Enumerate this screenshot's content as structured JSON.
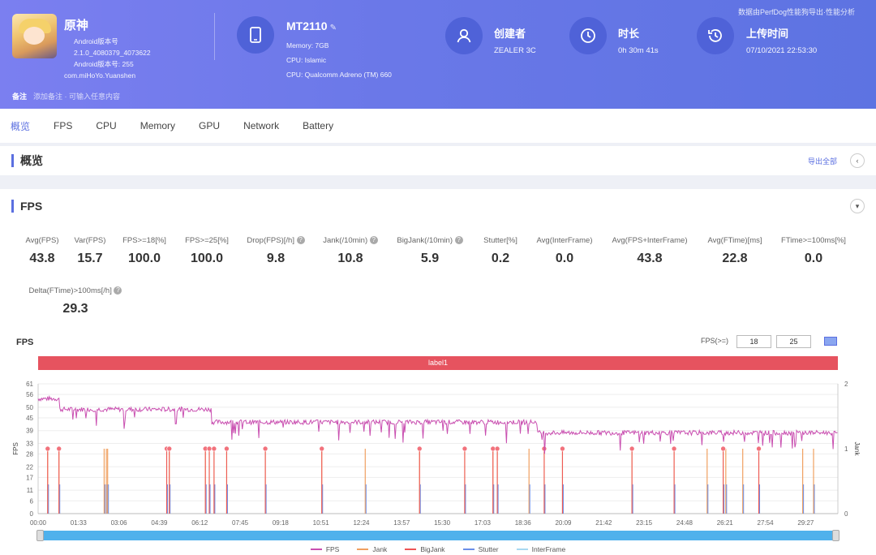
{
  "header": {
    "top_note": "数据由PerfDog性能狗导出·性能分析",
    "app": {
      "name": "原神",
      "lines": [
        "Android版本号",
        "2.1.0_4080379_4073622",
        "Android版本号: 255",
        "com.miHoYo.Yuanshen"
      ]
    },
    "device": {
      "name": "MT2110",
      "edit": "✎",
      "lines": [
        "Memory: 7GB",
        "CPU: Islamic",
        "CPU: Qualcomm Adreno (TM) 660"
      ]
    },
    "creator": {
      "label": "创建者",
      "value": "ZEALER 3C"
    },
    "duration": {
      "label": "时长",
      "value": "0h 30m 41s"
    },
    "upload": {
      "label": "上传时间",
      "value": "07/10/2021 22:53:30"
    },
    "note": {
      "label": "备注",
      "value": "添加备注 · 可输入任意内容"
    }
  },
  "tabs": [
    "概览",
    "FPS",
    "CPU",
    "Memory",
    "GPU",
    "Network",
    "Battery"
  ],
  "overview": {
    "title": "概览",
    "export": "导出全部",
    "collapse": "‹"
  },
  "fps": {
    "title": "FPS",
    "toggle": "▾",
    "metrics": [
      {
        "label": "Avg(FPS)",
        "value": "43.8",
        "info": false
      },
      {
        "label": "Var(FPS)",
        "value": "15.7",
        "info": false
      },
      {
        "label": "FPS>=18[%]",
        "value": "100.0",
        "info": false
      },
      {
        "label": "FPS>=25[%]",
        "value": "100.0",
        "info": false
      },
      {
        "label": "Drop(FPS)[/h]",
        "value": "9.8",
        "info": true
      },
      {
        "label": "Jank(/10min)",
        "value": "10.8",
        "info": true
      },
      {
        "label": "BigJank(/10min)",
        "value": "5.9",
        "info": true
      },
      {
        "label": "Stutter[%]",
        "value": "0.2",
        "info": false
      },
      {
        "label": "Avg(InterFrame)",
        "value": "0.0",
        "info": false
      },
      {
        "label": "Avg(FPS+InterFrame)",
        "value": "43.8",
        "info": false
      },
      {
        "label": "Avg(FTime)[ms]",
        "value": "22.8",
        "info": false
      },
      {
        "label": "FTime>=100ms[%]",
        "value": "0.0",
        "info": false
      },
      {
        "label": "Delta(FTime)>100ms[/h]",
        "value": "29.3",
        "info": true
      }
    ],
    "chart_label": "FPS",
    "filter_label": "FPS(>=)",
    "filter_values": [
      "18",
      "25"
    ],
    "label_bar": "label1",
    "info_icon": "?"
  },
  "chart_data": {
    "type": "line",
    "ylabel": "FPS",
    "y2label": "Jank",
    "y_ticks": [
      0,
      6,
      11,
      17,
      22,
      28,
      33,
      39,
      45,
      50,
      56,
      61
    ],
    "y2_ticks": [
      0,
      1,
      2
    ],
    "ylim": [
      0,
      61
    ],
    "y2lim": [
      0,
      2
    ],
    "x_ticks": [
      "00:00",
      "01:33",
      "03:06",
      "04:39",
      "06:12",
      "07:45",
      "09:18",
      "10:51",
      "12:24",
      "13:57",
      "15:30",
      "17:03",
      "18:36",
      "20:09",
      "21:42",
      "23:15",
      "24:48",
      "26:21",
      "27:54",
      "29:27"
    ],
    "x_range_s": [
      0,
      1841
    ],
    "fps_segments": [
      {
        "start_s": 0,
        "end_s": 50,
        "fps": 54
      },
      {
        "start_s": 50,
        "end_s": 400,
        "fps": 49
      },
      {
        "start_s": 400,
        "end_s": 1150,
        "fps": 43
      },
      {
        "start_s": 1150,
        "end_s": 1841,
        "fps": 38
      }
    ],
    "bigjank_s": [
      22,
      48,
      296,
      302,
      385,
      394,
      405,
      434,
      523,
      653,
      878,
      982,
      1047,
      1057,
      1165,
      1207,
      1367,
      1464,
      1577,
      1659
    ],
    "jank_s": [
      22,
      48,
      152,
      157,
      160,
      296,
      302,
      385,
      394,
      405,
      434,
      523,
      653,
      753,
      878,
      982,
      1047,
      1057,
      1130,
      1165,
      1207,
      1367,
      1464,
      1540,
      1577,
      1583,
      1622,
      1659,
      1760,
      1785
    ],
    "series": [
      {
        "name": "FPS",
        "color": "#c94fb0"
      },
      {
        "name": "Jank",
        "color": "#f0a060"
      },
      {
        "name": "BigJank",
        "color": "#ee5555"
      },
      {
        "name": "Stutter",
        "color": "#6b8ee8"
      },
      {
        "name": "InterFrame",
        "color": "#a8d8f0"
      }
    ]
  }
}
